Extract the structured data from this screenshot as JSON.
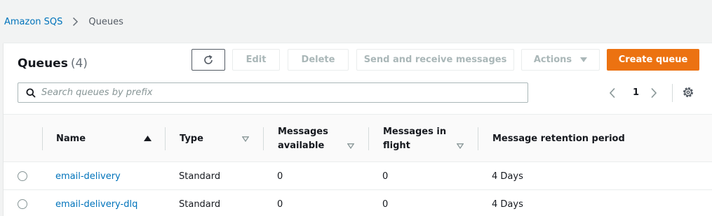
{
  "breadcrumb": {
    "root": "Amazon SQS",
    "current": "Queues"
  },
  "panel": {
    "title": "Queues",
    "count": "(4)"
  },
  "toolbar": {
    "edit_label": "Edit",
    "delete_label": "Delete",
    "send_receive_label": "Send and receive messages",
    "actions_label": "Actions",
    "create_label": "Create queue"
  },
  "search": {
    "placeholder": "Search queues by prefix",
    "value": ""
  },
  "pagination": {
    "current_page": "1"
  },
  "table": {
    "columns": [
      {
        "label": "Name"
      },
      {
        "label": "Type"
      },
      {
        "label": "Messages available"
      },
      {
        "label": "Messages in flight"
      },
      {
        "label": "Message retention period"
      }
    ],
    "rows": [
      {
        "name": "email-delivery",
        "type": "Standard",
        "available": "0",
        "in_flight": "0",
        "retention": "4 Days"
      },
      {
        "name": "email-delivery-dlq",
        "type": "Standard",
        "available": "0",
        "in_flight": "0",
        "retention": "4 Days"
      }
    ]
  },
  "colors": {
    "link": "#0073bb",
    "primary_button": "#ec7211",
    "disabled_text": "#aab7b8",
    "background": "#f2f3f3"
  },
  "icons": {
    "breadcrumb_separator": "chevron-right-icon",
    "refresh": "refresh-icon",
    "actions_caret": "caret-down-icon",
    "search": "search-icon",
    "prev": "chevron-left-icon",
    "next": "chevron-right-icon",
    "settings": "gear-icon",
    "sort_active": "sort-ascending-icon",
    "sort_inactive": "sort-neutral-icon"
  }
}
